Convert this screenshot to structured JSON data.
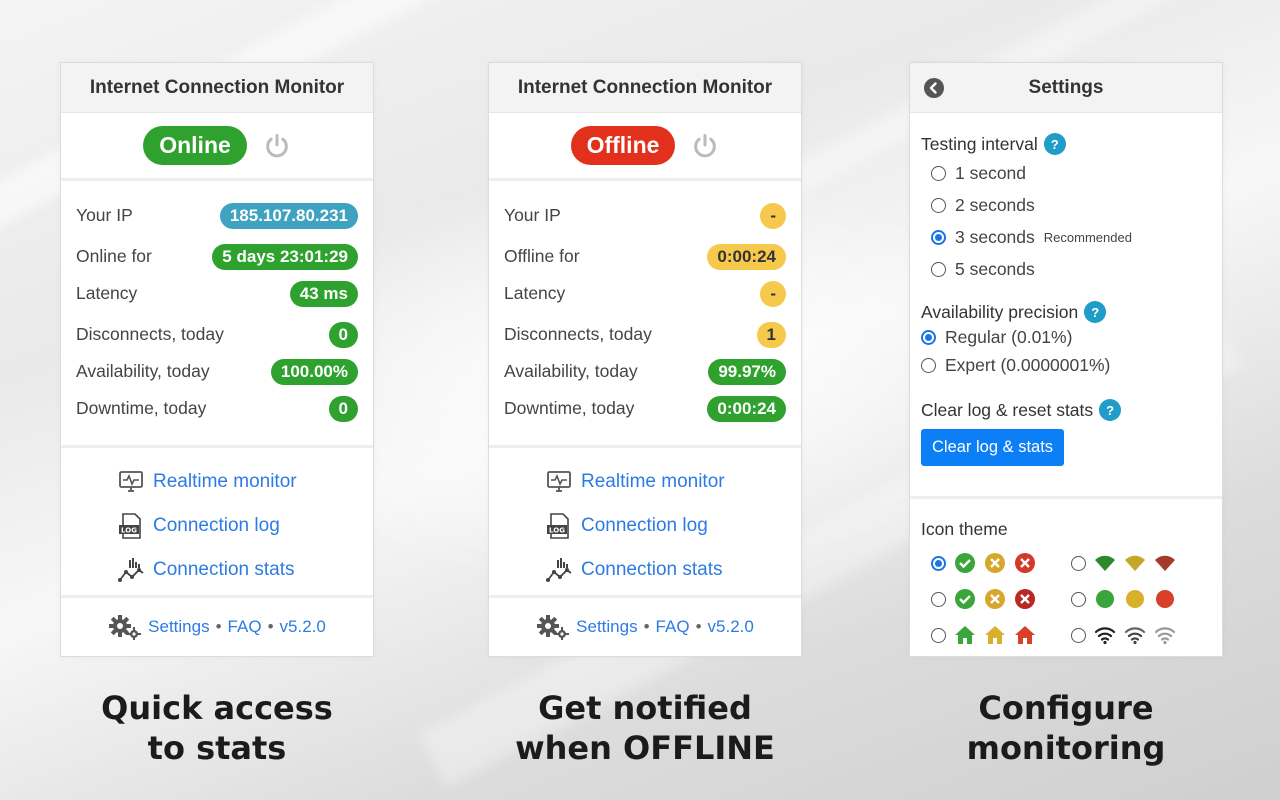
{
  "panels": {
    "online": {
      "header": "Internet Connection Monitor",
      "status": "Online",
      "stats": [
        {
          "label": "Your IP",
          "value": "185.107.80.231"
        },
        {
          "label": "Online for",
          "value": "5 days 23:01:29"
        },
        {
          "label": "Latency",
          "value": "43 ms"
        },
        {
          "label": "Disconnects, today",
          "value": "0"
        },
        {
          "label": "Availability, today",
          "value": "100.00%"
        },
        {
          "label": "Downtime, today",
          "value": "0"
        }
      ],
      "links": [
        "Realtime monitor",
        "Connection log",
        "Connection stats"
      ],
      "footer": {
        "settings": "Settings",
        "faq": "FAQ",
        "version": "v5.2.0",
        "sep": "•"
      },
      "caption": [
        "Quick access",
        "to stats"
      ]
    },
    "offline": {
      "header": "Internet Connection Monitor",
      "status": "Offline",
      "stats": [
        {
          "label": "Your IP",
          "value": "-"
        },
        {
          "label": "Offline for",
          "value": "0:00:24"
        },
        {
          "label": "Latency",
          "value": "-"
        },
        {
          "label": "Disconnects, today",
          "value": "1"
        },
        {
          "label": "Availability, today",
          "value": "99.97%"
        },
        {
          "label": "Downtime, today",
          "value": "0:00:24"
        }
      ],
      "links": [
        "Realtime monitor",
        "Connection log",
        "Connection stats"
      ],
      "footer": {
        "settings": "Settings",
        "faq": "FAQ",
        "version": "v5.2.0",
        "sep": "•"
      },
      "caption": [
        "Get notified",
        "when OFFLINE"
      ]
    },
    "settings": {
      "header": "Settings",
      "testing_interval": {
        "title": "Testing interval",
        "options": [
          "1 second",
          "2 seconds",
          "3 seconds",
          "5 seconds"
        ],
        "recommended": "Recommended",
        "selected": "3 seconds"
      },
      "precision": {
        "title": "Availability precision",
        "options": [
          "Regular (0.01%)",
          "Expert (0.0000001%)"
        ],
        "selected": "Regular (0.01%)"
      },
      "clear": {
        "title": "Clear log & reset stats",
        "button": "Clear log & stats"
      },
      "icon_theme": {
        "title": "Icon theme",
        "selected": "check-circles"
      },
      "help": "?",
      "caption": [
        "Configure",
        "monitoring"
      ]
    }
  },
  "colors": {
    "online": "#2ea12e",
    "offline": "#e2301c",
    "ip_badge": "#3ea3c0",
    "warning": "#f6c94c",
    "link": "#2c7be5",
    "button": "#0d7ff6",
    "help": "#1f9cc7"
  }
}
